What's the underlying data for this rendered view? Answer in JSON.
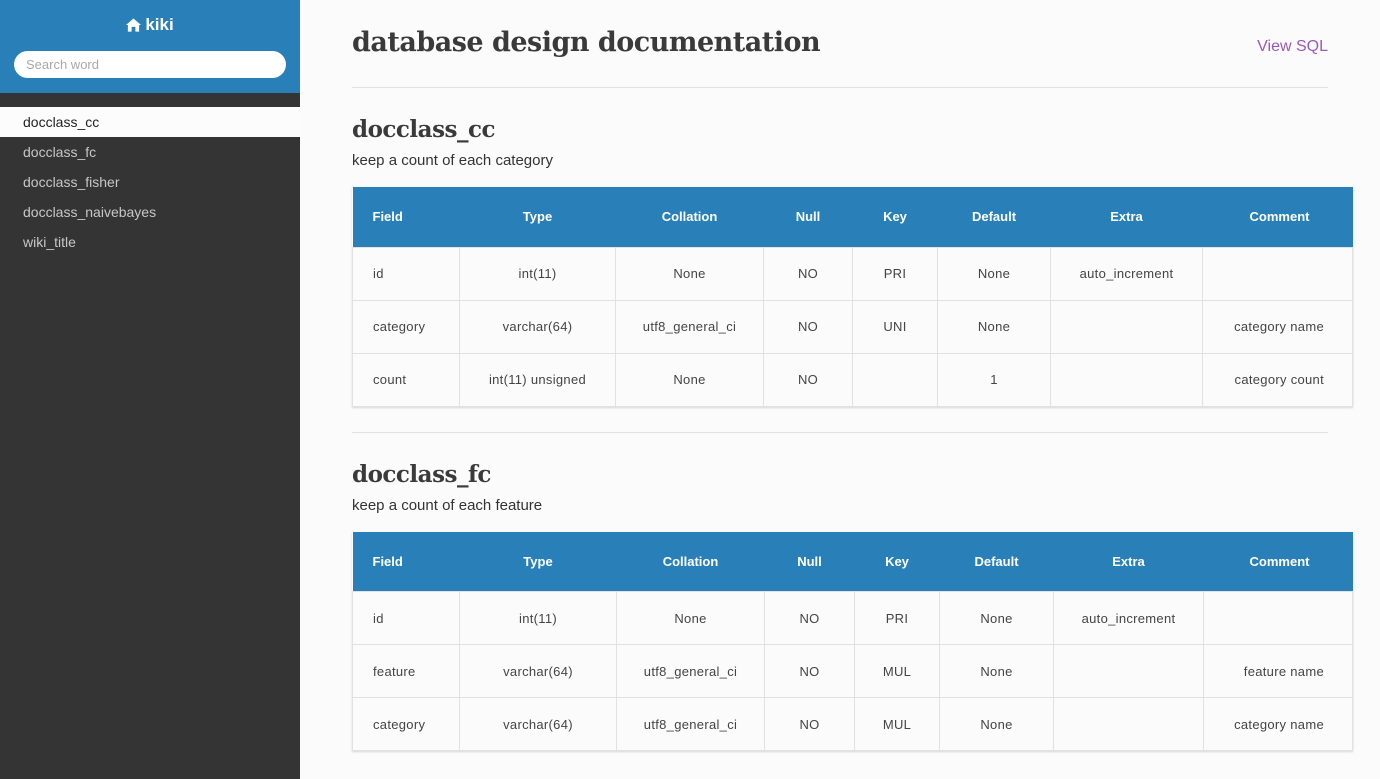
{
  "sidebar": {
    "brand": "kiki",
    "search_placeholder": "Search word",
    "items": [
      {
        "label": "docclass_cc"
      },
      {
        "label": "docclass_fc"
      },
      {
        "label": "docclass_fisher"
      },
      {
        "label": "docclass_naivebayes"
      },
      {
        "label": "wiki_title"
      }
    ],
    "active_index": 0
  },
  "header": {
    "title": "database design documentation",
    "view_sql": "View SQL"
  },
  "columns": [
    "Field",
    "Type",
    "Collation",
    "Null",
    "Key",
    "Default",
    "Extra",
    "Comment"
  ],
  "tables": [
    {
      "name": "docclass_cc",
      "description": "keep a count of each category",
      "rows": [
        [
          "id",
          "int(11)",
          "None",
          "NO",
          "PRI",
          "None",
          "auto_increment",
          ""
        ],
        [
          "category",
          "varchar(64)",
          "utf8_general_ci",
          "NO",
          "UNI",
          "None",
          "",
          "category name"
        ],
        [
          "count",
          "int(11) unsigned",
          "None",
          "NO",
          "",
          "1",
          "",
          "category count"
        ]
      ]
    },
    {
      "name": "docclass_fc",
      "description": "keep a count of each feature",
      "rows": [
        [
          "id",
          "int(11)",
          "None",
          "NO",
          "PRI",
          "None",
          "auto_increment",
          ""
        ],
        [
          "feature",
          "varchar(64)",
          "utf8_general_ci",
          "NO",
          "MUL",
          "None",
          "",
          "feature name"
        ],
        [
          "category",
          "varchar(64)",
          "utf8_general_ci",
          "NO",
          "MUL",
          "None",
          "",
          "category name"
        ]
      ]
    }
  ],
  "colors": {
    "accent": "#2980b9",
    "sidebar_bg": "#343434",
    "link": "#9b59b6"
  }
}
